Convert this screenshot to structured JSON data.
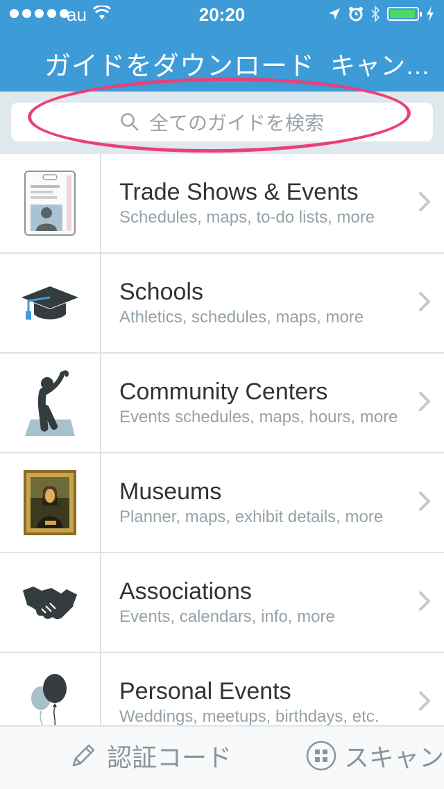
{
  "status_bar": {
    "carrier": "au",
    "time": "20:20",
    "battery_level": 0.95,
    "icons": [
      "signal-icon",
      "wifi-icon",
      "location-icon",
      "alarm-icon",
      "bluetooth-icon",
      "battery-icon",
      "charging-icon"
    ]
  },
  "nav": {
    "title": "ガイドをダウンロード",
    "cancel_label": "キャン…"
  },
  "search": {
    "placeholder": "全てのガイドを検索",
    "highlight_color": "#ec3f78"
  },
  "categories": [
    {
      "title": "Trade Shows & Events",
      "subtitle": "Schedules, maps, to-do lists, more",
      "icon": "badge-icon"
    },
    {
      "title": "Schools",
      "subtitle": "Athletics, schedules, maps, more",
      "icon": "graduation-cap-icon"
    },
    {
      "title": "Community Centers",
      "subtitle": "Events schedules, maps, hours, more",
      "icon": "stretching-person-icon"
    },
    {
      "title": "Museums",
      "subtitle": "Planner, maps, exhibit details, more",
      "icon": "framed-painting-icon"
    },
    {
      "title": "Associations",
      "subtitle": "Events, calendars, info, more",
      "icon": "handshake-icon"
    },
    {
      "title": "Personal Events",
      "subtitle": "Weddings, meetups, birthdays, etc.",
      "icon": "balloons-icon"
    }
  ],
  "bottom_bar": {
    "auth_code_label": "認証コード",
    "scan_label": "スキャン"
  },
  "colors": {
    "header": "#3d9bd8",
    "accent": "#3d9bd8",
    "annotation": "#ec3f78"
  }
}
